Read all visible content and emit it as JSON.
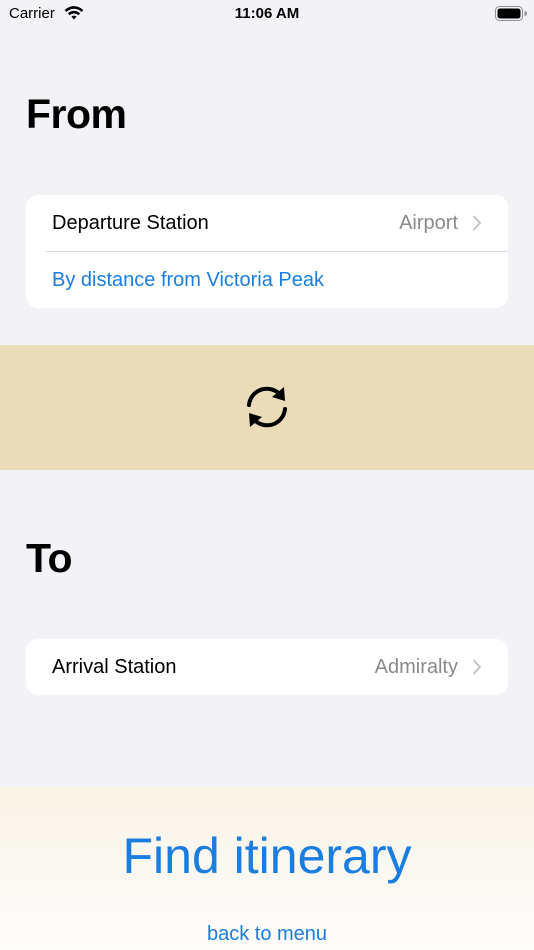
{
  "status_bar": {
    "carrier": "Carrier",
    "time": "11:06 AM"
  },
  "from_section": {
    "title": "From",
    "departure_label": "Departure Station",
    "departure_value": "Airport",
    "distance_link": "By distance from Victoria Peak"
  },
  "to_section": {
    "title": "To",
    "arrival_label": "Arrival Station",
    "arrival_value": "Admiralty"
  },
  "actions": {
    "find_label": "Find itinerary",
    "back_label": "back to menu"
  },
  "icons": {
    "swap": "swap-icon",
    "chevron": "chevron-right-icon"
  },
  "colors": {
    "accent": "#1a7ee0",
    "band": "#eadcb9",
    "background": "#f2f2f7",
    "secondary_text": "#8a8a8e"
  }
}
